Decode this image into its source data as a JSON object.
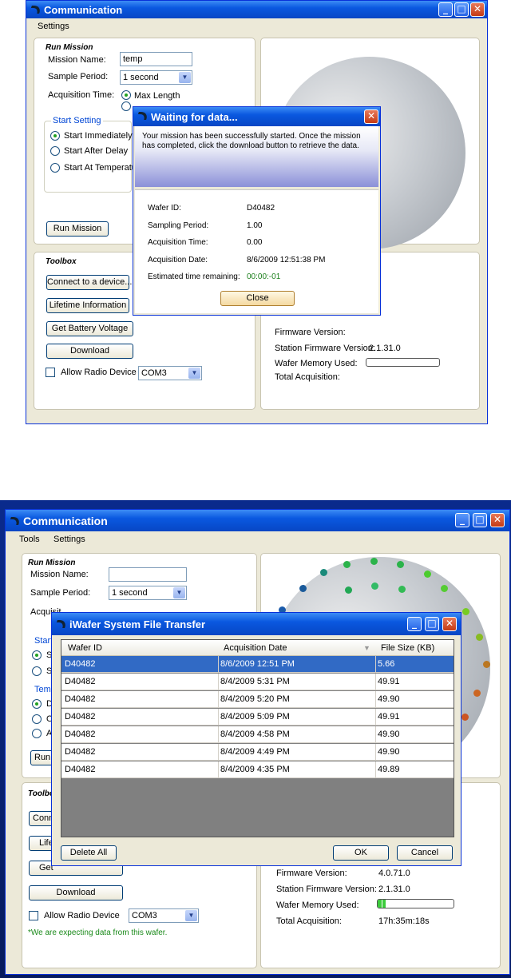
{
  "screen1": {
    "window_title": "Communication",
    "menu": [
      "Settings"
    ],
    "run_mission": {
      "title": "Run Mission",
      "mission_name_label": "Mission Name:",
      "mission_name_value": "temp",
      "sample_period_label": "Sample Period:",
      "sample_period_value": "1 second",
      "acquisition_time_label": "Acquisition Time:",
      "max_length_label": "Max Length",
      "start_setting_title": "Start Setting",
      "start_options": [
        "Start Immediately",
        "Start After Delay",
        "Start At Temperature"
      ],
      "run_button": "Run Mission"
    },
    "toolbox": {
      "title": "Toolbox",
      "buttons": [
        "Connect to a device...",
        "Lifetime Information",
        "Get Battery Voltage",
        "Download"
      ],
      "allow_radio_label": "Allow Radio Device",
      "com_value": "COM3"
    },
    "info": {
      "firmware_label": "Firmware Version:",
      "station_firmware_label": "Station Firmware Version:",
      "station_firmware_value": "2.1.31.0",
      "memory_label": "Wafer Memory Used:",
      "total_acq_label": "Total Acquisition:"
    },
    "dialog": {
      "title": "Waiting for data...",
      "message": "Your mission has been successfully started.  Once the mission has completed, click the download button to retrieve the data.",
      "fields": [
        {
          "label": "Wafer ID:",
          "value": "D40482"
        },
        {
          "label": "Sampling Period:",
          "value": "1.00"
        },
        {
          "label": "Acquisition Time:",
          "value": "0.00"
        },
        {
          "label": "Acquisition Date:",
          "value": "8/6/2009 12:51:38 PM"
        },
        {
          "label": "Estimated time remaining:",
          "value": "00:00:-01"
        }
      ],
      "close_button": "Close"
    }
  },
  "screen2": {
    "window_title": "Communication",
    "menu": [
      "Tools",
      "Settings"
    ],
    "run_mission": {
      "title": "Run Mission",
      "mission_name_label": "Mission Name:",
      "sample_period_label": "Sample Period:",
      "sample_period_value": "1 second",
      "acquisition_partial": "Acquisit",
      "partial_labels": [
        "Start",
        "S",
        "S",
        "Temp",
        "D",
        "O",
        "A",
        "Run"
      ]
    },
    "toolbox": {
      "title": "Toolbo",
      "partial_buttons": [
        "Conn",
        "Life",
        "Get"
      ],
      "download_button": "Download",
      "allow_radio_label": "Allow Radio Device",
      "com_value": "COM3",
      "note": "*We are expecting data from this wafer."
    },
    "info": {
      "firmware_label": "Firmware Version:",
      "firmware_value": "4.0.71.0",
      "station_firmware_label": "Station Firmware Version:",
      "station_firmware_value": "2.1.31.0",
      "memory_label": "Wafer Memory Used:",
      "memory_fraction": 0.1,
      "total_acq_label": "Total Acquisition:",
      "total_acq_value": "17h:35m:18s"
    },
    "dialog": {
      "title": "iWafer System File Transfer",
      "columns": [
        "Wafer ID",
        "Acquisition Date",
        "File Size (KB)"
      ],
      "rows": [
        [
          "D40482",
          "8/6/2009 12:51 PM",
          "5.66"
        ],
        [
          "D40482",
          "8/4/2009 5:31 PM",
          "49.91"
        ],
        [
          "D40482",
          "8/4/2009 5:20 PM",
          "49.90"
        ],
        [
          "D40482",
          "8/4/2009 5:09 PM",
          "49.91"
        ],
        [
          "D40482",
          "8/4/2009 4:58 PM",
          "49.90"
        ],
        [
          "D40482",
          "8/4/2009 4:49 PM",
          "49.90"
        ],
        [
          "D40482",
          "8/4/2009 4:35 PM",
          "49.89"
        ]
      ],
      "delete_button": "Delete All",
      "ok_button": "OK",
      "cancel_button": "Cancel"
    }
  },
  "colors": {
    "title_blue": "#0a58e0",
    "selected_row": "#316ac5",
    "group_title": "#0046d5",
    "success_green": "#1a7f1a"
  }
}
